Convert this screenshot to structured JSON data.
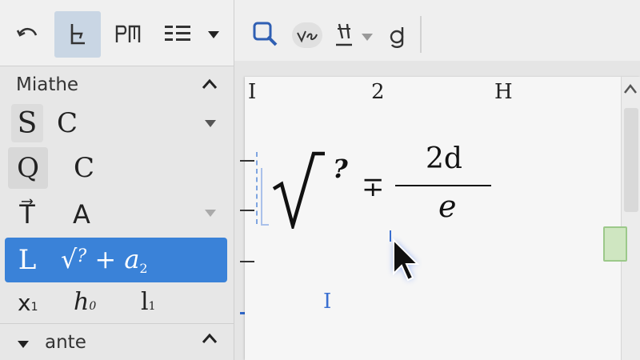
{
  "left_panel": {
    "section1_title": "Miathe",
    "section2_title": "ante",
    "rows": [
      {
        "left": "S",
        "right": "C"
      },
      {
        "left": "Q",
        "right": "C"
      },
      {
        "left": "T⃗",
        "right": "A"
      },
      {
        "left": "L",
        "formula_base": "√",
        "formula_arg": "?",
        "formula_rest": "+ a",
        "formula_sub": "2"
      },
      {
        "c1": "x",
        "c1_sub": "1",
        "c2": "h",
        "c2_sub": "0",
        "c3": "l",
        "c3_sub": "1"
      }
    ]
  },
  "canvas": {
    "col_heads": [
      "I",
      "2",
      "H"
    ],
    "sqrt_arg": "?",
    "operator": "∓",
    "numerator": "2d",
    "denominator": "e",
    "cursor_caret": "I"
  },
  "colors": {
    "accent": "#3a82d8",
    "selection_bg": "#c9d6e4",
    "ruler_blue": "#2f66c9",
    "green_marker": "#9cc98a"
  },
  "icons": {
    "toolbar_left": [
      "undo-icon",
      "format-insert-icon",
      "paragraph-icon",
      "list-icon",
      "chevron-down-icon"
    ],
    "toolbar_right": [
      "zoom-icon",
      "handwriting-icon",
      "underline-style-icon",
      "chevron-down-icon",
      "font-style-icon"
    ]
  }
}
